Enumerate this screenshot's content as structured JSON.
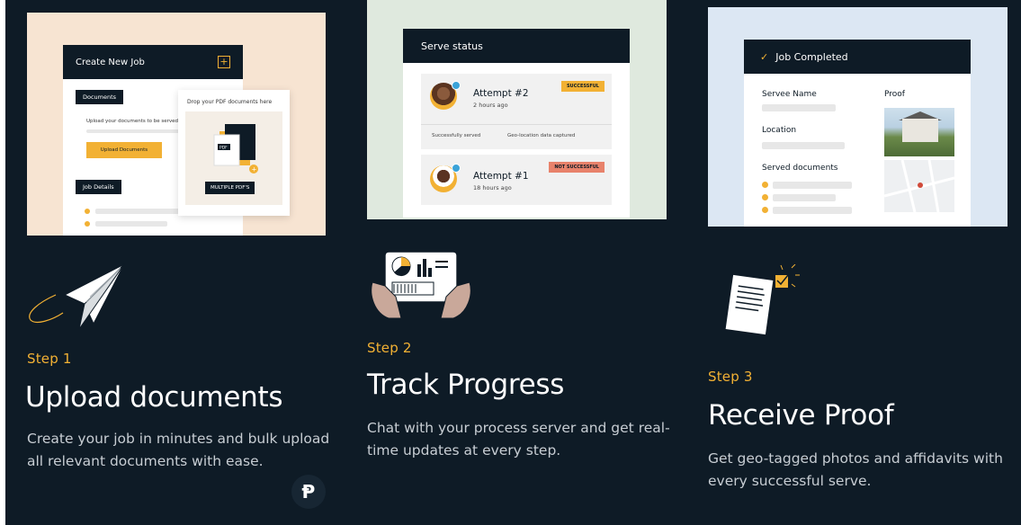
{
  "colors": {
    "background": "#0e1b26",
    "accent": "#f2b134",
    "card1_bg": "#f7e4d2",
    "card2_bg": "#dfe9de",
    "card3_bg": "#dce7f3",
    "success_badge": "#f2b134",
    "fail_badge": "#e8826b"
  },
  "steps": [
    {
      "label": "Step 1",
      "title": "Upload documents",
      "description_line1": "Create your job in minutes and bulk upload",
      "description_line2": "all relevant documents with ease.",
      "icon": "paper-plane-icon",
      "mockup": {
        "header": "Create New Job",
        "documents_tag": "Documents",
        "upload_hint": "Upload your documents to be served",
        "upload_button": "Upload Documents",
        "job_details_tag": "Job Details",
        "drop_title": "Drop your PDF documents here",
        "pdf_label": "PDF",
        "multiple_label": "MULTIPLE PDF'S"
      }
    },
    {
      "label": "Step 2",
      "title": "Track Progress",
      "description_line1": "Chat with your process server and get real-",
      "description_line2": "time updates at every step.",
      "icon": "tablet-chart-icon",
      "mockup": {
        "header": "Serve status",
        "attempts": [
          {
            "title": "Attempt #2",
            "time": "2 hours ago",
            "badge": "SUCCESSFUL"
          },
          {
            "title": "Attempt #1",
            "time": "18 hours ago",
            "badge": "NOT SUCCESSFUL"
          }
        ],
        "check1": "Successfully served",
        "check2": "Geo-location data captured"
      }
    },
    {
      "label": "Step 3",
      "title": "Receive Proof",
      "description_line1": "Get geo-tagged photos and affidavits with",
      "description_line2": "every successful serve.",
      "icon": "document-checklist-icon",
      "mockup": {
        "header": "Job Completed",
        "servee_name": "Servee Name",
        "proof": "Proof",
        "location": "Location",
        "served_documents": "Served documents"
      }
    }
  ],
  "logo_glyph": "Ᵽ"
}
